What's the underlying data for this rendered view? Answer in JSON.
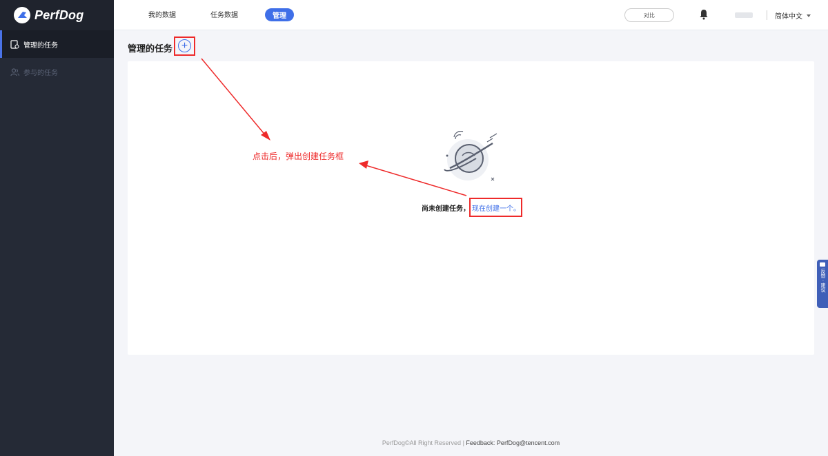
{
  "app": {
    "name": "PerfDog"
  },
  "sidebar": {
    "items": [
      {
        "label": "管理的任务",
        "active": true
      },
      {
        "label": "参与的任务",
        "active": false
      }
    ]
  },
  "header": {
    "nav": [
      "我的数据",
      "任务数据",
      "管理"
    ],
    "active_nav": "管理",
    "compare_label": "对比",
    "language": "简体中文"
  },
  "main": {
    "title": "管理的任务",
    "add_icon": "plus-circle-icon",
    "empty_text": "尚未创建任务，",
    "create_link": "现在创建一个。",
    "annotation": "点击后，弹出创建任务框"
  },
  "feedback_tab": {
    "label": "反馈 · 建议"
  },
  "footer": {
    "copyright": "PerfDog©All Right Reserved",
    "separator": " | ",
    "feedback": "Feedback: PerfDog@tencent.com"
  },
  "colors": {
    "sidebar_bg": "#252a36",
    "accent": "#3f6fe8",
    "annotation_red": "#ee2a2a",
    "page_bg": "#f4f5f9"
  }
}
